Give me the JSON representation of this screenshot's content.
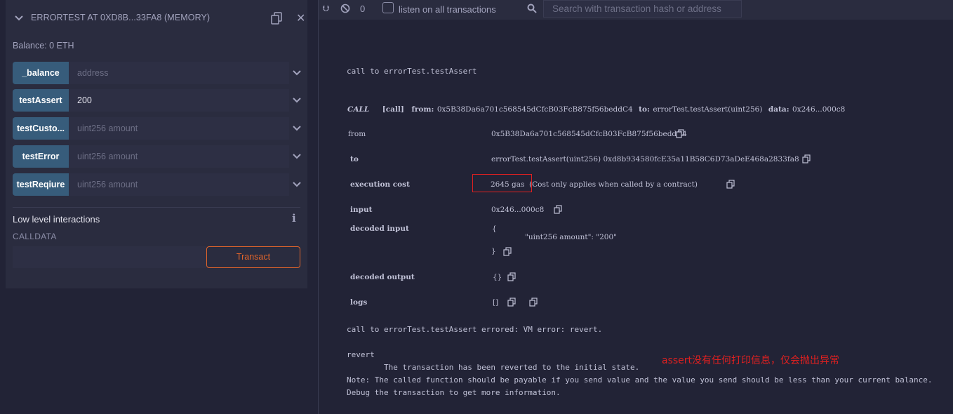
{
  "contract": {
    "title": "ERRORTEST AT 0XD8B...33FA8 (MEMORY)",
    "balance": "Balance: 0 ETH",
    "functions": [
      {
        "label": "_balance",
        "value": "",
        "placeholder": "address"
      },
      {
        "label": "testAssert",
        "value": "200",
        "placeholder": ""
      },
      {
        "label": "testCusto...",
        "value": "",
        "placeholder": "uint256 amount"
      },
      {
        "label": "testError",
        "value": "",
        "placeholder": "uint256 amount"
      },
      {
        "label": "testReqiure",
        "value": "",
        "placeholder": "uint256 amount"
      }
    ],
    "low_level_title": "Low level interactions",
    "calldata_label": "CALLDATA",
    "transact_label": "Transact"
  },
  "terminal_bar": {
    "count": "0",
    "listen_label": "listen on all transactions",
    "search_placeholder": "Search with transaction hash or address"
  },
  "terminal": {
    "call_to": "call to errorTest.testAssert",
    "call_line": {
      "kind": "CALL",
      "call": "[call]",
      "from_k": "from:",
      "from_v": "0x5B38Da6a701c568545dCfcB03FcB875f56beddC4",
      "to_k": "to:",
      "to_v": "errorTest.testAssert(uint256)",
      "data_k": "data:",
      "data_v": "0x246...000c8"
    },
    "rows": {
      "from_k": "from",
      "from_v": "0x5B38Da6a701c568545dCfcB03FcB875f56beddC4",
      "to_k": "to",
      "to_v": "errorTest.testAssert(uint256) 0xd8b934580fcE35a11B58C6D73aDeE468a2833fa8",
      "exec_k": "execution cost",
      "exec_gas": "2645 gas",
      "exec_note": "(Cost only applies when called by a contract)",
      "input_k": "input",
      "input_v": "0x246...000c8",
      "decoded_input_k": "decoded input",
      "decoded_input_open": "{",
      "decoded_input_body": "\"uint256 amount\": \"200\"",
      "decoded_input_close": "}",
      "decoded_output_k": "decoded output",
      "decoded_output_v": "{}",
      "logs_k": "logs",
      "logs_v": "[]"
    },
    "errored": "call to errorTest.testAssert errored: VM error: revert.",
    "revert": "revert",
    "reverted_msg": "The transaction has been reverted to the initial state.",
    "note": "Note: The called function should be payable if you send value and the value you send should be less than your current balance.",
    "debug": "Debug the transaction to get more information.",
    "annotation": "assert没有任何打印信息，仅会抛出异常"
  },
  "colors": {
    "accent": "#e0642b",
    "fn_button": "#375c7b",
    "highlight": "#e02020"
  }
}
